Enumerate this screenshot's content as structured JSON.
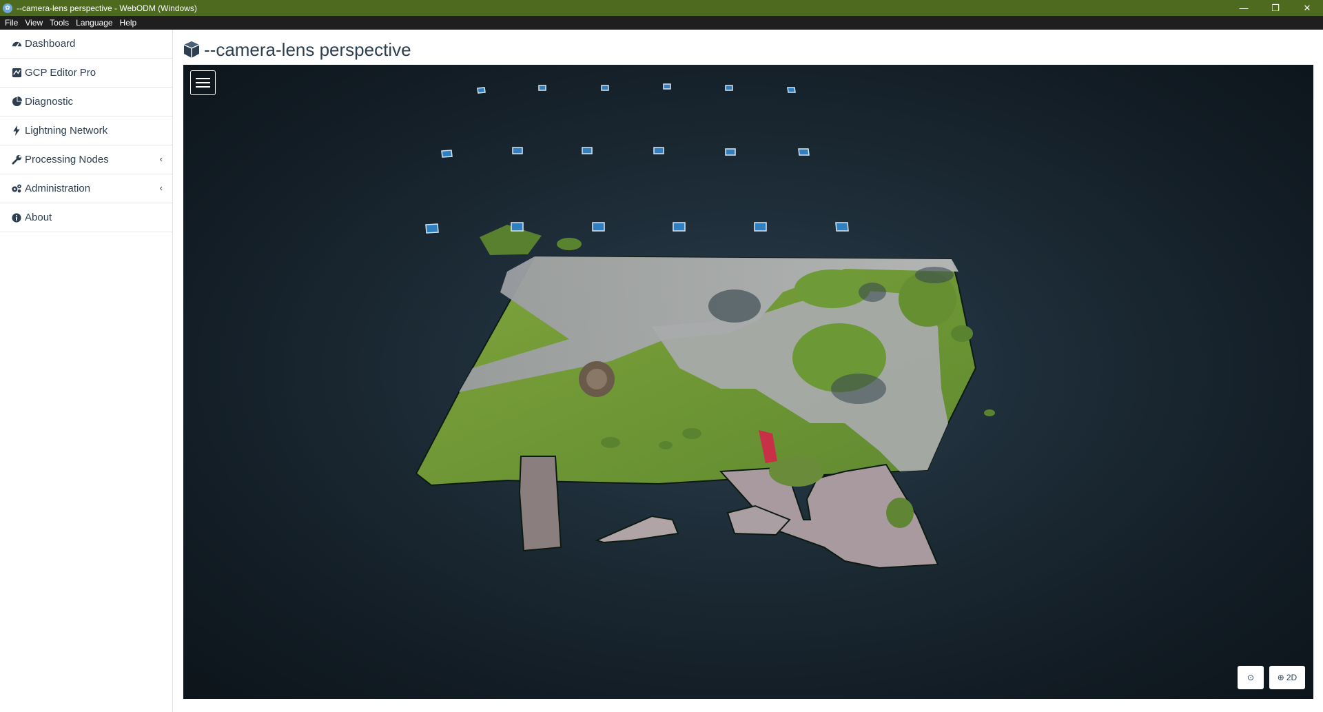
{
  "window": {
    "title": "--camera-lens perspective - WebODM (Windows)",
    "minimize": "—",
    "restore": "❐",
    "close": "✕"
  },
  "menubar": {
    "items": [
      "File",
      "View",
      "Tools",
      "Language",
      "Help"
    ]
  },
  "sidebar": {
    "items": [
      {
        "label": "Dashboard",
        "icon": "dashboard-icon"
      },
      {
        "label": "GCP Editor Pro",
        "icon": "gcp-icon"
      },
      {
        "label": "Diagnostic",
        "icon": "pie-chart-icon"
      },
      {
        "label": "Lightning Network",
        "icon": "bolt-icon"
      },
      {
        "label": "Processing Nodes",
        "icon": "wrench-icon",
        "chevron": "‹"
      },
      {
        "label": "Administration",
        "icon": "gears-icon",
        "chevron": "‹"
      },
      {
        "label": "About",
        "icon": "info-icon"
      }
    ]
  },
  "page": {
    "title": "--camera-lens perspective"
  },
  "viewer": {
    "button_2d": "2D",
    "compass_glyph": "⊙",
    "globe_glyph": "⊕"
  },
  "colors": {
    "titlebar": "#4d6a1e",
    "menubar": "#1f1f1f",
    "text": "#2c3e50",
    "viewer_bg": "#1d2c37",
    "camera_blue": "#2f7fc1"
  }
}
